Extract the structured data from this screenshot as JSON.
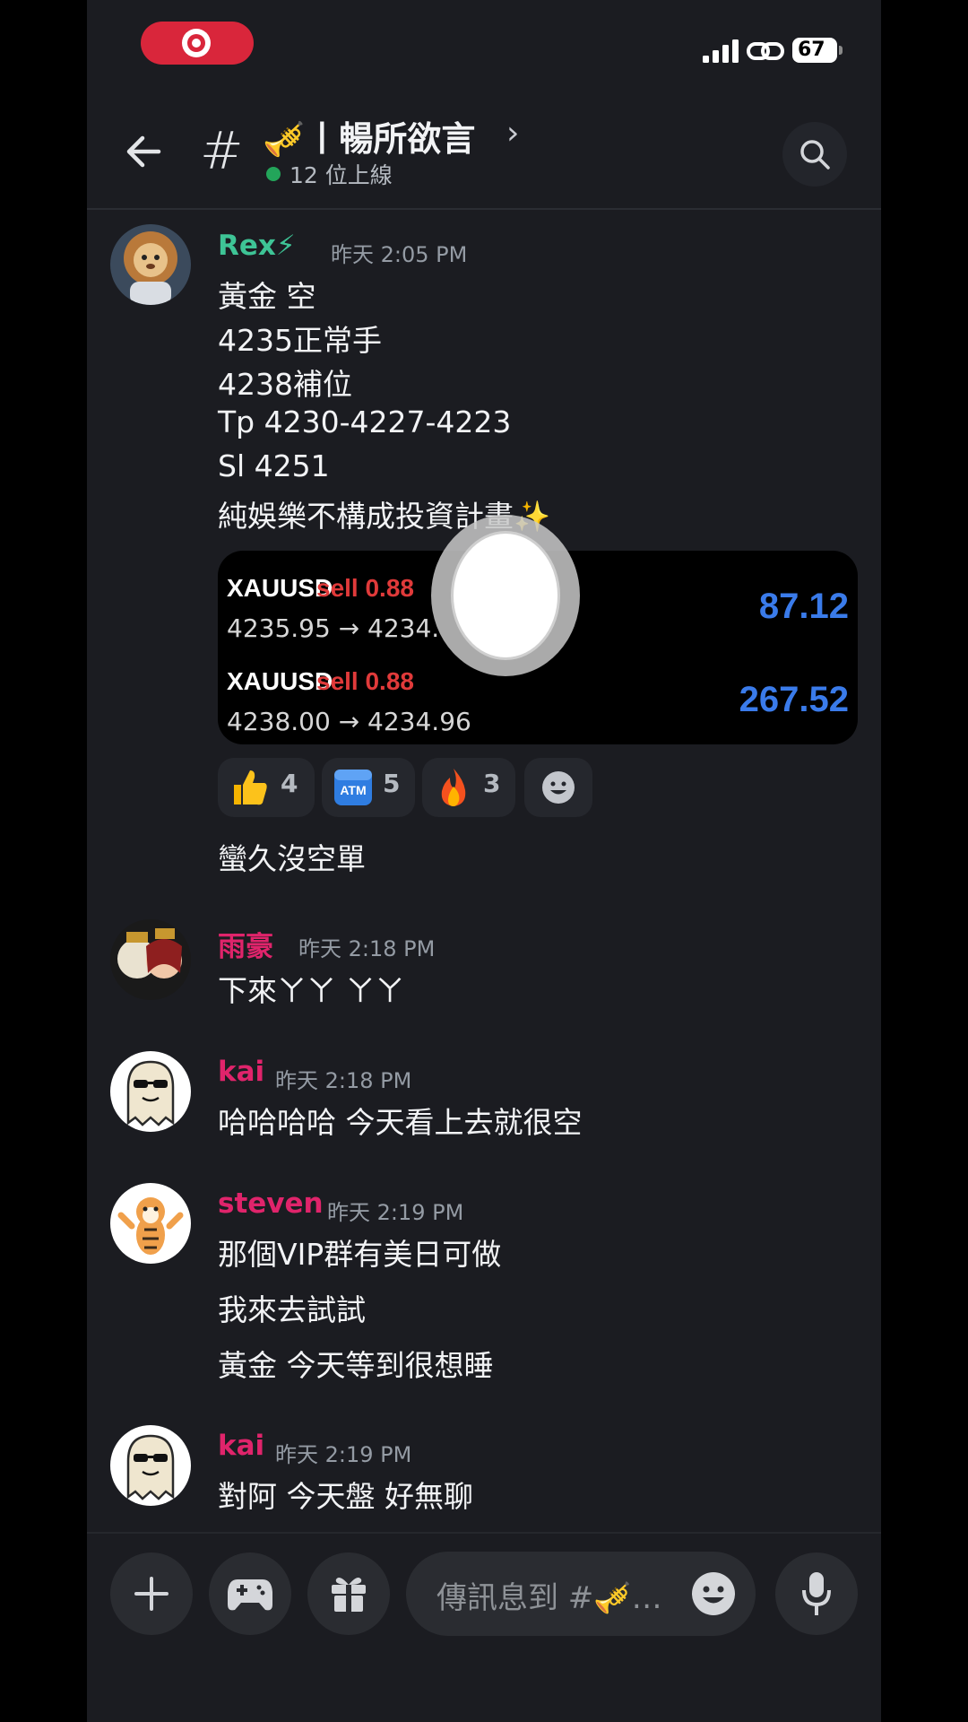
{
  "status_bar": {
    "battery": "67"
  },
  "header": {
    "channel_name": "🎺丨暢所欲言",
    "online": "12 位上線"
  },
  "messages": [
    {
      "user": "Rex⚡",
      "time": "昨天 2:05 PM",
      "lines": [
        "黃金 空",
        "4235正常手",
        "4238補位",
        "Tp 4230-4227-4223",
        "Sl  4251",
        "純娛樂不構成投資計畫✨"
      ],
      "trades": [
        {
          "symbol": "XAUUSD",
          "side": "sell 0.88",
          "prices": "4235.95 → 4234.",
          "profit": "87.12"
        },
        {
          "symbol": "XAUUSD",
          "side": "sell 0.88",
          "prices": "4238.00 → 4234.96",
          "profit": "267.52"
        }
      ],
      "reactions": [
        {
          "emoji": "thumbs-up",
          "count": "4"
        },
        {
          "emoji": "atm",
          "count": "5"
        },
        {
          "emoji": "fire",
          "count": "3"
        }
      ],
      "followup": "蠻久沒空單"
    },
    {
      "user": "雨豪",
      "time": "昨天 2:18 PM",
      "lines": [
        "下來ㄚㄚ ㄚㄚ"
      ]
    },
    {
      "user": "kai",
      "time": "昨天 2:18 PM",
      "lines": [
        "哈哈哈哈 今天看上去就很空"
      ]
    },
    {
      "user": "steven",
      "time": "昨天 2:19 PM",
      "lines": [
        "那個VIP群有美日可做",
        "我來去試試",
        "黃金 今天等到很想睡"
      ]
    },
    {
      "user": "kai",
      "time": "昨天 2:19 PM",
      "lines": [
        "對阿 今天盤 好無聊"
      ]
    }
  ],
  "composer": {
    "placeholder": "傳訊息到 #🎺…"
  },
  "colors": {
    "background": "#1b1c21",
    "rex": "#3ec496",
    "pink_user": "#e0246b",
    "online": "#23a55a",
    "sell": "#e03a3a",
    "profit": "#3a7bea"
  }
}
